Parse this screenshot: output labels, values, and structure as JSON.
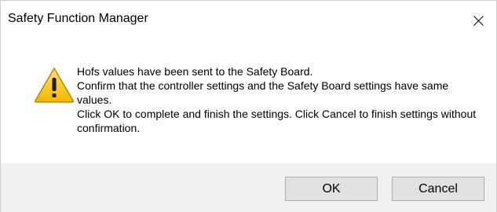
{
  "window": {
    "title": "Safety Function Manager",
    "close_icon": "close-icon"
  },
  "dialog": {
    "icon": "warning-icon",
    "message_lines": [
      "Hofs values have been sent to the Safety Board.",
      "Confirm that the controller settings and the Safety Board settings have same values.",
      "Click OK to complete and finish the settings. Click Cancel to finish settings without confirmation."
    ]
  },
  "buttons": {
    "ok_label": "OK",
    "cancel_label": "Cancel"
  },
  "colors": {
    "footer_bg": "#f0f0f0",
    "button_bg": "#e1e1e1",
    "button_border": "#adadad",
    "warning_fill": "#f5c400"
  }
}
